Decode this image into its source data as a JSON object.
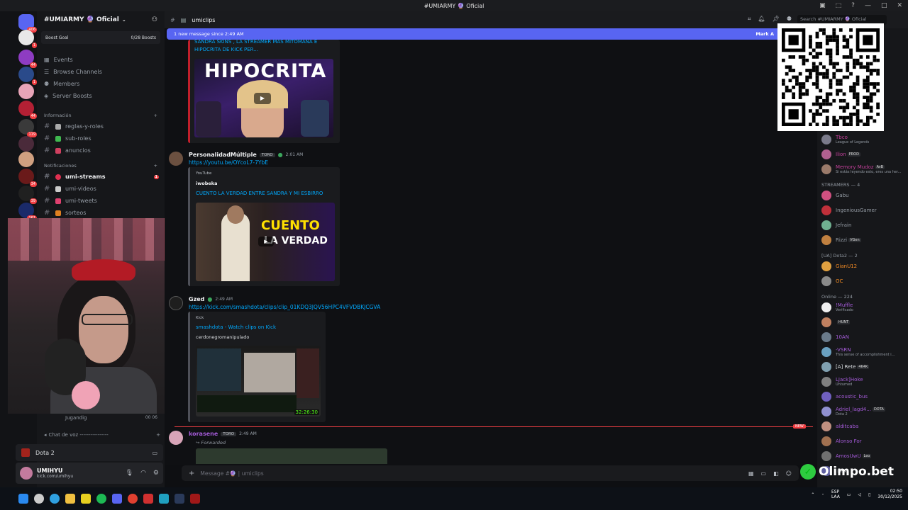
{
  "window": {
    "title": "#UMIARMY 🔮 Oficial"
  },
  "guild": {
    "name": "#UMIARMY 🔮 Oficial",
    "boost_goal_label": "Boost Goal",
    "boost_goal_value": "0/28 Boosts"
  },
  "sidebar": {
    "nav": [
      "Events",
      "Browse Channels",
      "Members",
      "Server Boosts"
    ],
    "categories": [
      {
        "label": "Información",
        "channels": [
          "reglas-y-roles",
          "sub-roles",
          "anuncios"
        ]
      },
      {
        "label": "Notificaciones",
        "channels": [
          "umi-streams",
          "umi-videos",
          "umi-tweets",
          "sorteos"
        ]
      }
    ],
    "unread_badge": "1",
    "voice_item": "Jugandig",
    "voice_counts": "00 06",
    "voice_category": "Chat de voz ----------------"
  },
  "servers": {
    "badges": [
      "406",
      "1",
      "44",
      "1",
      "44",
      "119",
      "34",
      "39",
      "161"
    ]
  },
  "activity": {
    "game": "Dota 2"
  },
  "user": {
    "name": "UMIHYU",
    "sub": "kick.com/umihyu"
  },
  "header": {
    "channel": "umiclips",
    "search_placeholder": "Search #UMIARMY 🔮 Oficial"
  },
  "new_messages": {
    "text": "1 new message since 2:49 AM",
    "action": "Mark A"
  },
  "messages": [
    {
      "embed_title": "SANDRA SKINS , LA STREAMER MAS MITOMANA E HIPOCRITA DE KICK PER...",
      "thumb_text": "HIPOCRITA"
    },
    {
      "author": "PersonalidadMúltiple",
      "tag": "TORO",
      "time": "2:01 AM",
      "link": "https://youtu.be/OYcoL7-7YbE",
      "embed_provider": "YouTube",
      "embed_author": "iwobeka",
      "embed_title": "CUENTO LA VERDAD ENTRE SANDRA Y MI ESBIRRO",
      "thumb_text_1": "CUENTO",
      "thumb_text_2": "LA VERDAD"
    },
    {
      "author": "Gzed",
      "time": "2:49 AM",
      "link": "https://kick.com/smashdota/clips/clip_01KDQ3JQV56HPC4VFVDBKJCGVA",
      "embed_provider": "Kick",
      "embed_title": "smashdota - Watch clips on Kick",
      "embed_desc": "cerdonegromanipulado",
      "duration": "32:26:30"
    },
    {
      "author": "korasene",
      "tag": "TORO",
      "time": "2:49 AM",
      "forwarded": "Forwarded"
    }
  ],
  "new_badge": "NEW",
  "composer": {
    "placeholder": "Message #🔮 | umiclips"
  },
  "members": {
    "top": [
      {
        "name": "Tbco",
        "sub": "League of Legends",
        "color": "#c3409a"
      },
      {
        "name": "Ilion",
        "tag": "PROD",
        "color": "#c3409a"
      },
      {
        "name": "Memory Mudoz",
        "tag": "AvB",
        "sub": "Si estás leyendo esto, eres una her...",
        "color": "#c3409a"
      }
    ],
    "groups": [
      {
        "label": "STREAMERS — 4",
        "items": [
          {
            "name": "Gabu",
            "color": "#949ba4"
          },
          {
            "name": "IngeniousGamer",
            "color": "#949ba4"
          },
          {
            "name": "Jefrain",
            "color": "#949ba4"
          },
          {
            "name": "Rizzi",
            "tag": "VGen",
            "color": "#949ba4"
          }
        ]
      },
      {
        "label": "[UA] Dota2 — 2",
        "items": [
          {
            "name": "GianU12",
            "color": "#f08a24"
          },
          {
            "name": "OC",
            "color": "#f08a24"
          }
        ]
      },
      {
        "label": "Online — 224",
        "items": [
          {
            "name": "!Muffle",
            "sub": "Verificado",
            "color": "#a35ad6"
          },
          {
            "name": "",
            "tag": "HUNT",
            "color": "#a35ad6"
          },
          {
            "name": "10AN",
            "color": "#a35ad6"
          },
          {
            "name": "-VSRN",
            "sub": "This sense of accomplishment i...",
            "color": "#a35ad6"
          },
          {
            "name": "[A] Rete",
            "tag": "4K4K",
            "color": "#dbdee1"
          },
          {
            "name": "LJack]Hoke",
            "sub": "Unturned",
            "color": "#a35ad6"
          },
          {
            "name": "acoustic_bus",
            "color": "#a35ad6"
          },
          {
            "name": "Adriel_lagd4...",
            "tag": "DOTA",
            "sub": "Dota 2",
            "color": "#a35ad6"
          },
          {
            "name": "alditcaba",
            "color": "#a35ad6"
          },
          {
            "name": "Alonso For",
            "color": "#a35ad6"
          },
          {
            "name": "AmosUwU",
            "tag": "Leo",
            "color": "#a35ad6"
          },
          {
            "name": "",
            "tag": "SRN",
            "color": "#a35ad6"
          }
        ]
      }
    ]
  },
  "overlay": {
    "brand": "Olimpo.bet"
  },
  "tray": {
    "lang": "ESP",
    "lang2": "LAA",
    "time": "02:50",
    "date": "30/12/2025"
  }
}
